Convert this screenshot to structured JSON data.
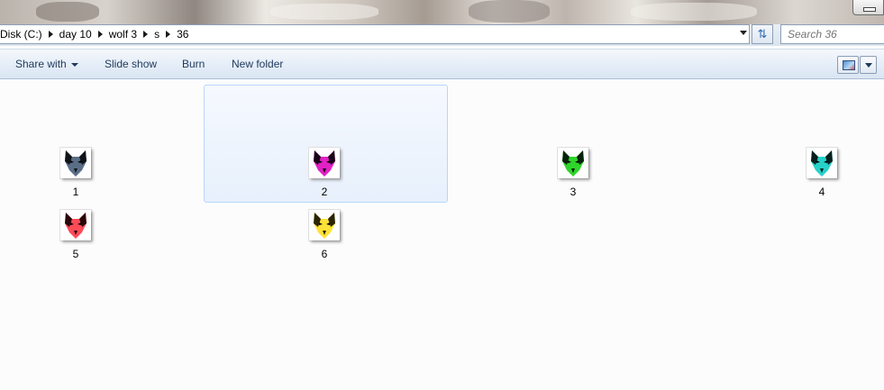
{
  "window": {},
  "address": {
    "crumbs": [
      {
        "label": "Disk (C:)"
      },
      {
        "label": "day 10"
      },
      {
        "label": "wolf 3"
      },
      {
        "label": "s"
      },
      {
        "label": "36"
      }
    ]
  },
  "search": {
    "placeholder": "Search 36"
  },
  "toolbar": {
    "share_label": "Share with",
    "slideshow_label": "Slide show",
    "burn_label": "Burn",
    "newfolder_label": "New folder"
  },
  "files": [
    {
      "name": "1",
      "color": "#5a6e86",
      "selected": false
    },
    {
      "name": "2",
      "color": "#e021c4",
      "selected": true
    },
    {
      "name": "3",
      "color": "#2fd52a",
      "selected": false
    },
    {
      "name": "4",
      "color": "#27d1c9",
      "selected": false
    },
    {
      "name": "5",
      "color": "#ff4a58",
      "selected": false
    },
    {
      "name": "6",
      "color": "#ffe238",
      "selected": false
    }
  ],
  "icons": {
    "refresh": "refresh-icon",
    "view": "change-view-icon",
    "wolf": "wolf-head-icon"
  }
}
